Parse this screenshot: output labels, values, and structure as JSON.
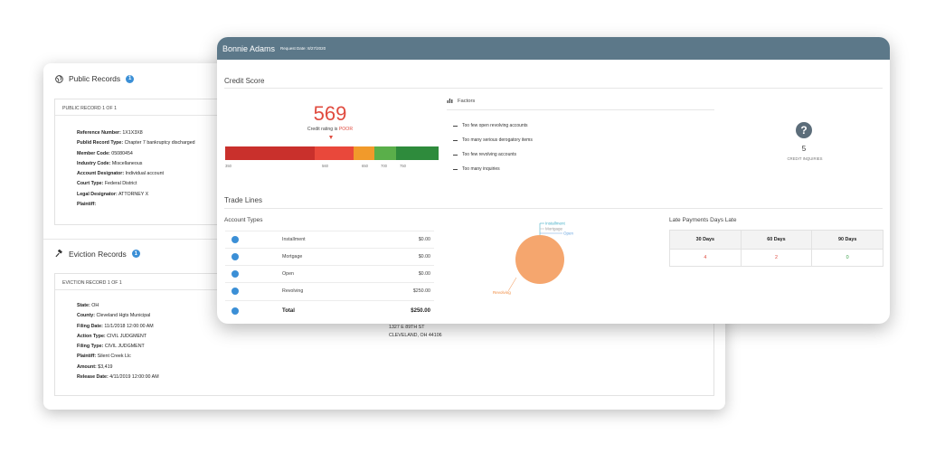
{
  "public_records": {
    "title": "Public Records",
    "info_count": "1",
    "record_title": "PUBLIC RECORD 1 OF 1",
    "fields": [
      {
        "label": "Reference Number:",
        "value": "1X1X3X8"
      },
      {
        "label": "Publid Record Type:",
        "value": "Chapter 7 bankruptcy discharged"
      },
      {
        "label": "Member Code:",
        "value": "05080454"
      },
      {
        "label": "Industry Code:",
        "value": "Miscellaneous"
      },
      {
        "label": "Account Designator:",
        "value": "Individual account"
      },
      {
        "label": "Court Type:",
        "value": "Federal District"
      },
      {
        "label": "Legal Designator:",
        "value": "ATTORNEY X"
      },
      {
        "label": "Plaintiff:",
        "value": ""
      }
    ]
  },
  "eviction_records": {
    "title": "Eviction Records",
    "info_count": "1",
    "record_title": "EVICTION RECORD 1 OF 1",
    "fields": [
      {
        "label": "State:",
        "value": "OH"
      },
      {
        "label": "County:",
        "value": "Cleveland Hgts Municipal"
      },
      {
        "label": "Filing Date:",
        "value": "11/1/2018 12:00:00 AM"
      },
      {
        "label": "Action Type:",
        "value": "CIVIL JUDGMENT"
      },
      {
        "label": "Filing Type:",
        "value": "CIVIL JUDGMENT"
      },
      {
        "label": "Plaintiff:",
        "value": "Silent Creek Llc"
      },
      {
        "label": "Amount:",
        "value": "$3,419"
      },
      {
        "label": "Release Date:",
        "value": "4/11/2019 12:00:00 AM"
      }
    ],
    "address_line1": "1327 E 89TH ST",
    "address_line2": "CLEVELAND, OH 44106"
  },
  "report": {
    "name": "Bonnie Adams",
    "request_date": "Request Date: 8/27/2020"
  },
  "credit_score": {
    "section_title": "Credit Score",
    "score": "569",
    "rating_prefix": "Credit rating is",
    "rating": "POOR",
    "scale_ticks": [
      "350",
      "560",
      "650",
      "700",
      "750"
    ],
    "scale_colors": [
      "#c9302c",
      "#e9483b",
      "#f19a2b",
      "#5aaf4a",
      "#2e8b3c"
    ],
    "factors_title": "Factors",
    "factors": [
      "Too few open revolving accounts",
      "Too many serious derogatory items",
      "Too few revolving accounts",
      "Too many inquiries"
    ],
    "inquiries_count": "5",
    "inquiries_label": "CREDIT INQUIRIES"
  },
  "trade_lines": {
    "section_title": "Trade Lines",
    "account_types_title": "Account Types",
    "accounts": [
      {
        "label": "Installment",
        "amount": "$0.00"
      },
      {
        "label": "Mortgage",
        "amount": "$0.00"
      },
      {
        "label": "Open",
        "amount": "$0.00"
      },
      {
        "label": "Revolving",
        "amount": "$250.00"
      }
    ],
    "total_label": "Total",
    "total_amount": "$250.00",
    "pie_labels": [
      "Installment",
      "Mortgage",
      "Open",
      "Revolving"
    ],
    "pie_color": "#f5a66e",
    "late_title": "Late Payments Days Late",
    "late_headers": [
      "30 Days",
      "60 Days",
      "90 Days"
    ],
    "late_values": [
      "4",
      "2",
      "0"
    ],
    "late_colors": [
      "#e04b3f",
      "#e04b3f",
      "#3aa14a"
    ]
  }
}
